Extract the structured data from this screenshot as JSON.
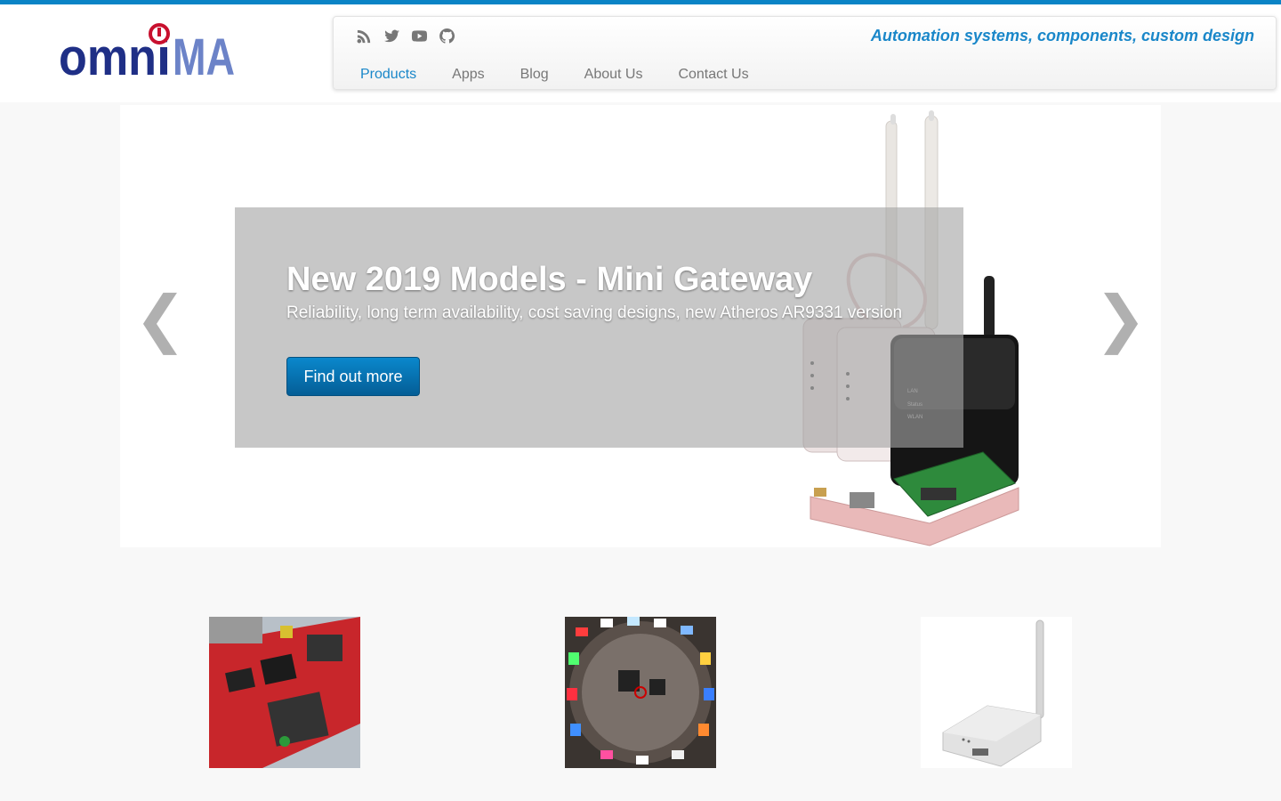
{
  "brand": {
    "logo_text": "OMNIMA"
  },
  "header": {
    "tagline": "Automation systems, components, custom design",
    "social_icons": [
      "rss-icon",
      "twitter-icon",
      "youtube-icon",
      "github-icon"
    ],
    "nav": [
      {
        "label": "Products",
        "active": true
      },
      {
        "label": "Apps",
        "active": false
      },
      {
        "label": "Blog",
        "active": false
      },
      {
        "label": "About Us",
        "active": false
      },
      {
        "label": "Contact Us",
        "active": false
      }
    ]
  },
  "carousel": {
    "title": "New 2019 Models - Mini Gateway",
    "subtitle": "Reliability, long term availability, cost saving designs, new Atheros AR9331 version",
    "button_label": "Find out more",
    "prev_glyph": "❮",
    "next_glyph": "❯"
  },
  "products": [
    {
      "image": "red-circuit-board-photo"
    },
    {
      "image": "led-ring-board-photo"
    },
    {
      "image": "white-wifi-router-photo"
    }
  ],
  "colors": {
    "accent": "#1a87c9",
    "top_stripe": "#0a84c6",
    "button": "#0a78b8"
  }
}
